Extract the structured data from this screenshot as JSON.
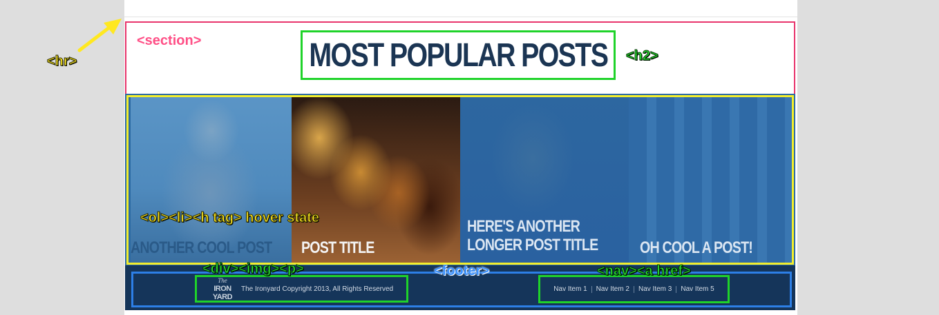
{
  "annotations": {
    "hr": "<hr>",
    "section": "<section>",
    "h2": "<h2>",
    "hover": "<ol><li><h tag> hover state",
    "div_img_p": "<div><img><p>",
    "footer": "<footer>",
    "nav": "<nav><a href>"
  },
  "heading": "MOST POPULAR POSTS",
  "posts": [
    {
      "title": "ANOTHER COOL POST"
    },
    {
      "title": "POST TITLE"
    },
    {
      "title_line1": "HERE'S ANOTHER",
      "title_line2": "LONGER POST TITLE"
    },
    {
      "title": "OH COOL A POST!"
    }
  ],
  "footer": {
    "logo_the": "The",
    "logo_iron": "IRON",
    "logo_yard": "YARD",
    "copyright": "The Ironyard Copyright 2013, All Rights Reserved",
    "nav": [
      "Nav Item 1",
      "Nav Item 2",
      "Nav Item 3",
      "Nav Item 5"
    ]
  },
  "colors": {
    "section_outline": "#e8336b",
    "heading_outline": "#1fd32a",
    "posts_outline": "#f3ee2c",
    "footer_outline": "#2d7fe6",
    "footer_bg": "#15355a",
    "heading_text": "#1b3553",
    "post_overlay": "#2b6aa3"
  }
}
